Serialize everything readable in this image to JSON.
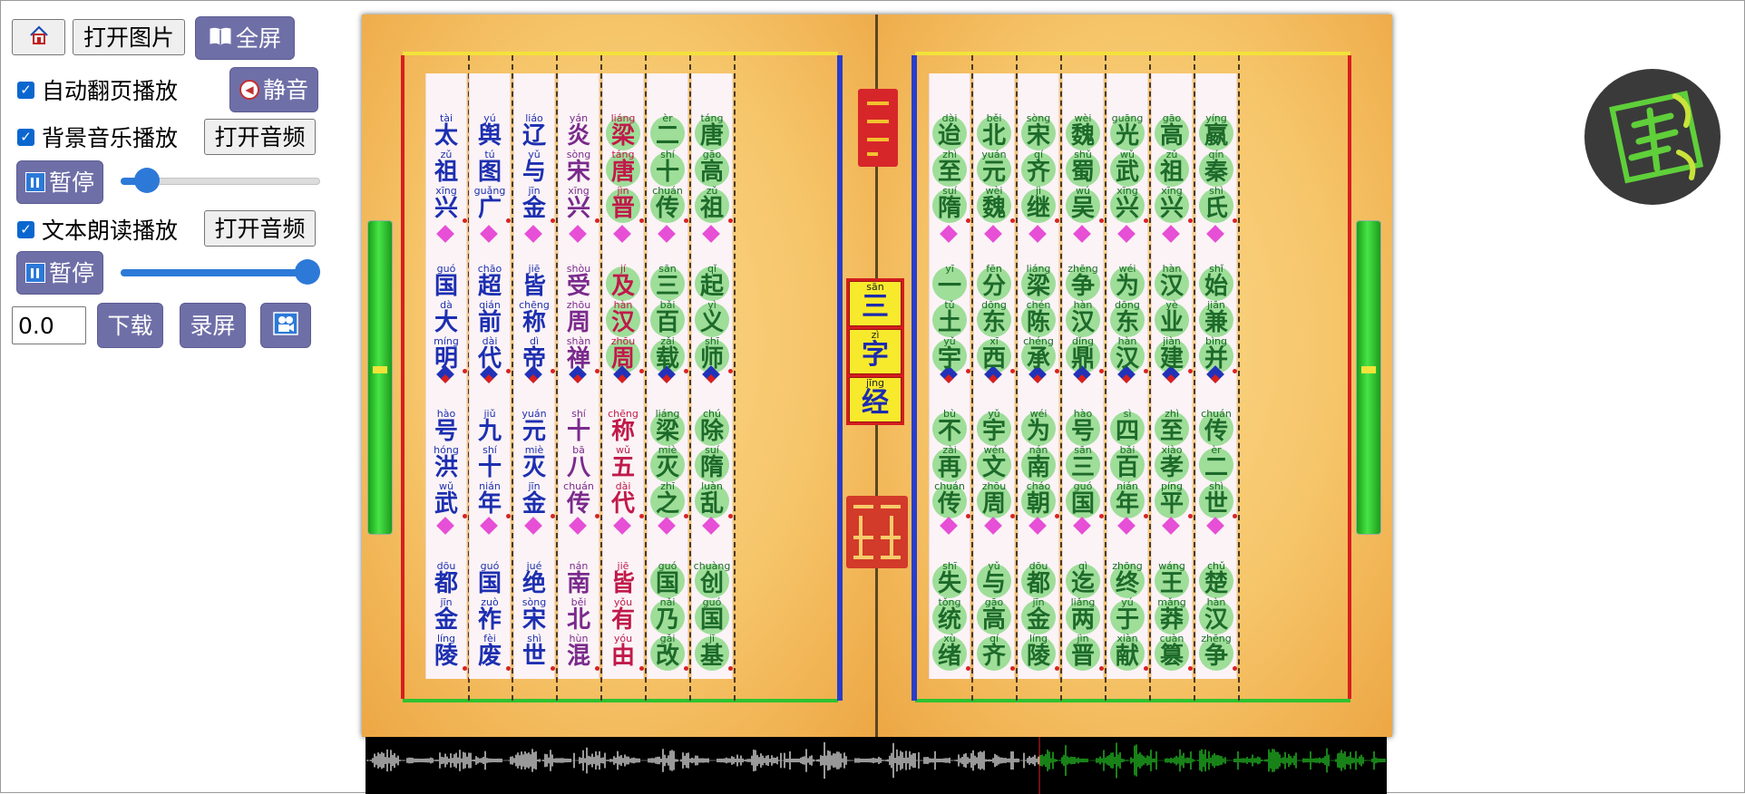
{
  "toolbar": {
    "home_icon": "home-icon",
    "open_image_label": "打开图片",
    "fullscreen_label": "全屏",
    "fullscreen_icon": "book-icon"
  },
  "controls": {
    "auto_flip": {
      "label": "自动翻页播放",
      "checked": true
    },
    "mute_label": "静音",
    "bg_music": {
      "label": "背景音乐播放",
      "checked": true,
      "open_audio_label": "打开音频"
    },
    "bg_pause_label": "暂停",
    "bg_volume": 0.08,
    "text_read": {
      "label": "文本朗读播放",
      "checked": true,
      "open_audio_label": "打开音频"
    },
    "text_pause_label": "暂停",
    "text_volume": 1.0,
    "time_value": "0.0",
    "download_label": "下载",
    "record_label": "录屏",
    "camera_icon": "camera-icon"
  },
  "book": {
    "title": [
      {
        "py": "sān",
        "hz": "三"
      },
      {
        "py": "zì",
        "hz": "字"
      },
      {
        "py": "jīng",
        "hz": "经"
      }
    ],
    "left_page_columns": [
      {
        "color": "#1d2fb0",
        "groups": [
          [
            [
              "tài",
              "太"
            ],
            [
              "zǔ",
              "祖"
            ],
            [
              "xīng",
              "兴"
            ]
          ],
          [
            [
              "guó",
              "国"
            ],
            [
              "dà",
              "大"
            ],
            [
              "míng",
              "明"
            ]
          ],
          [
            [
              "hào",
              "号"
            ],
            [
              "hóng",
              "洪"
            ],
            [
              "wǔ",
              "武"
            ]
          ],
          [
            [
              "dōu",
              "都"
            ],
            [
              "jīn",
              "金"
            ],
            [
              "líng",
              "陵"
            ]
          ]
        ]
      },
      {
        "color": "#1d2fb0",
        "groups": [
          [
            [
              "yú",
              "舆"
            ],
            [
              "tú",
              "图"
            ],
            [
              "guǎng",
              "广"
            ]
          ],
          [
            [
              "chāo",
              "超"
            ],
            [
              "qián",
              "前"
            ],
            [
              "dài",
              "代"
            ]
          ],
          [
            [
              "jiǔ",
              "九"
            ],
            [
              "shí",
              "十"
            ],
            [
              "nián",
              "年"
            ]
          ],
          [
            [
              "guó",
              "国"
            ],
            [
              "zuò",
              "祚"
            ],
            [
              "fèi",
              "废"
            ]
          ]
        ]
      },
      {
        "color": "#1d2fb0",
        "groups": [
          [
            [
              "liáo",
              "辽"
            ],
            [
              "yǔ",
              "与"
            ],
            [
              "jīn",
              "金"
            ]
          ],
          [
            [
              "jiē",
              "皆"
            ],
            [
              "chēng",
              "称"
            ],
            [
              "dì",
              "帝"
            ]
          ],
          [
            [
              "yuán",
              "元"
            ],
            [
              "miè",
              "灭"
            ],
            [
              "jīn",
              "金"
            ]
          ],
          [
            [
              "jué",
              "绝"
            ],
            [
              "sòng",
              "宋"
            ],
            [
              "shì",
              "世"
            ]
          ]
        ]
      },
      {
        "color": "#7a2a8c",
        "groups": [
          [
            [
              "yán",
              "炎"
            ],
            [
              "sòng",
              "宋"
            ],
            [
              "xīng",
              "兴"
            ]
          ],
          [
            [
              "shòu",
              "受"
            ],
            [
              "zhōu",
              "周"
            ],
            [
              "shàn",
              "禅"
            ]
          ],
          [
            [
              "shí",
              "十"
            ],
            [
              "bā",
              "八"
            ],
            [
              "chuán",
              "传"
            ]
          ],
          [
            [
              "nán",
              "南"
            ],
            [
              "běi",
              "北"
            ],
            [
              "hùn",
              "混"
            ]
          ]
        ]
      },
      {
        "color": "#c01a4a",
        "hl": [
          0,
          1
        ],
        "groups": [
          [
            [
              "liáng",
              "梁"
            ],
            [
              "táng",
              "唐"
            ],
            [
              "jìn",
              "晋"
            ]
          ],
          [
            [
              "jí",
              "及"
            ],
            [
              "hàn",
              "汉"
            ],
            [
              "zhōu",
              "周"
            ]
          ],
          [
            [
              "chēng",
              "称"
            ],
            [
              "wǔ",
              "五"
            ],
            [
              "dài",
              "代"
            ]
          ],
          [
            [
              "jiē",
              "皆"
            ],
            [
              "yǒu",
              "有"
            ],
            [
              "yóu",
              "由"
            ]
          ]
        ]
      },
      {
        "color": "#1d6a2a",
        "hl": [
          0,
          1,
          2,
          3
        ],
        "groups": [
          [
            [
              "èr",
              "二"
            ],
            [
              "shí",
              "十"
            ],
            [
              "chuán",
              "传"
            ]
          ],
          [
            [
              "sān",
              "三"
            ],
            [
              "bǎi",
              "百"
            ],
            [
              "zǎi",
              "载"
            ]
          ],
          [
            [
              "liáng",
              "梁"
            ],
            [
              "miè",
              "灭"
            ],
            [
              "zhī",
              "之"
            ]
          ],
          [
            [
              "guó",
              "国"
            ],
            [
              "nǎi",
              "乃"
            ],
            [
              "gǎi",
              "改"
            ]
          ]
        ]
      },
      {
        "color": "#1d6a2a",
        "hl": [
          0,
          1,
          2,
          3
        ],
        "groups": [
          [
            [
              "táng",
              "唐"
            ],
            [
              "gāo",
              "高"
            ],
            [
              "zǔ",
              "祖"
            ]
          ],
          [
            [
              "qǐ",
              "起"
            ],
            [
              "yì",
              "义"
            ],
            [
              "shī",
              "师"
            ]
          ],
          [
            [
              "chú",
              "除"
            ],
            [
              "suí",
              "隋"
            ],
            [
              "luàn",
              "乱"
            ]
          ],
          [
            [
              "chuàng",
              "创"
            ],
            [
              "guó",
              "国"
            ],
            [
              "jī",
              "基"
            ]
          ]
        ]
      }
    ],
    "right_page_columns": [
      {
        "color": "#1d6a2a",
        "hl": [
          0,
          1,
          2,
          3
        ],
        "groups": [
          [
            [
              "dài",
              "迨"
            ],
            [
              "zhì",
              "至"
            ],
            [
              "suí",
              "隋"
            ]
          ],
          [
            [
              "yī",
              "一"
            ],
            [
              "tǔ",
              "土"
            ],
            [
              "yǔ",
              "宇"
            ]
          ],
          [
            [
              "bù",
              "不"
            ],
            [
              "zài",
              "再"
            ],
            [
              "chuán",
              "传"
            ]
          ],
          [
            [
              "shī",
              "失"
            ],
            [
              "tǒng",
              "统"
            ],
            [
              "xù",
              "绪"
            ]
          ]
        ]
      },
      {
        "color": "#1d6a2a",
        "hl": [
          0,
          1,
          2,
          3
        ],
        "groups": [
          [
            [
              "běi",
              "北"
            ],
            [
              "yuán",
              "元"
            ],
            [
              "wèi",
              "魏"
            ]
          ],
          [
            [
              "fēn",
              "分"
            ],
            [
              "dōng",
              "东"
            ],
            [
              "xī",
              "西"
            ]
          ],
          [
            [
              "yǔ",
              "宇"
            ],
            [
              "wén",
              "文"
            ],
            [
              "zhōu",
              "周"
            ]
          ],
          [
            [
              "yǔ",
              "与"
            ],
            [
              "gāo",
              "高"
            ],
            [
              "qí",
              "齐"
            ]
          ]
        ]
      },
      {
        "color": "#1d6a2a",
        "hl": [
          0,
          1,
          2,
          3
        ],
        "groups": [
          [
            [
              "sòng",
              "宋"
            ],
            [
              "qí",
              "齐"
            ],
            [
              "jì",
              "继"
            ]
          ],
          [
            [
              "liáng",
              "梁"
            ],
            [
              "chén",
              "陈"
            ],
            [
              "chéng",
              "承"
            ]
          ],
          [
            [
              "wéi",
              "为"
            ],
            [
              "nán",
              "南"
            ],
            [
              "cháo",
              "朝"
            ]
          ],
          [
            [
              "dōu",
              "都"
            ],
            [
              "jīn",
              "金"
            ],
            [
              "líng",
              "陵"
            ]
          ]
        ]
      },
      {
        "color": "#1d6a2a",
        "hl": [
          0,
          1,
          2,
          3
        ],
        "groups": [
          [
            [
              "wèi",
              "魏"
            ],
            [
              "shǔ",
              "蜀"
            ],
            [
              "wú",
              "吴"
            ]
          ],
          [
            [
              "zhēng",
              "争"
            ],
            [
              "hàn",
              "汉"
            ],
            [
              "dǐng",
              "鼎"
            ]
          ],
          [
            [
              "hào",
              "号"
            ],
            [
              "sān",
              "三"
            ],
            [
              "guó",
              "国"
            ]
          ],
          [
            [
              "qì",
              "迄"
            ],
            [
              "liǎng",
              "两"
            ],
            [
              "jìn",
              "晋"
            ]
          ]
        ]
      },
      {
        "color": "#1d6a2a",
        "hl": [
          0,
          1,
          2,
          3
        ],
        "groups": [
          [
            [
              "guāng",
              "光"
            ],
            [
              "wǔ",
              "武"
            ],
            [
              "xīng",
              "兴"
            ]
          ],
          [
            [
              "wéi",
              "为"
            ],
            [
              "dōng",
              "东"
            ],
            [
              "hàn",
              "汉"
            ]
          ],
          [
            [
              "sì",
              "四"
            ],
            [
              "bǎi",
              "百"
            ],
            [
              "nián",
              "年"
            ]
          ],
          [
            [
              "zhōng",
              "终"
            ],
            [
              "yú",
              "于"
            ],
            [
              "xiàn",
              "献"
            ]
          ]
        ]
      },
      {
        "color": "#1d6a2a",
        "hl": [
          0,
          1,
          2,
          3
        ],
        "groups": [
          [
            [
              "gāo",
              "高"
            ],
            [
              "zǔ",
              "祖"
            ],
            [
              "xīng",
              "兴"
            ]
          ],
          [
            [
              "hàn",
              "汉"
            ],
            [
              "yè",
              "业"
            ],
            [
              "jiàn",
              "建"
            ]
          ],
          [
            [
              "zhì",
              "至"
            ],
            [
              "xiào",
              "孝"
            ],
            [
              "píng",
              "平"
            ]
          ],
          [
            [
              "wáng",
              "王"
            ],
            [
              "mǎng",
              "莽"
            ],
            [
              "cuàn",
              "篡"
            ]
          ]
        ]
      },
      {
        "color": "#1d6a2a",
        "hl": [
          0,
          1,
          2,
          3
        ],
        "groups": [
          [
            [
              "yíng",
              "嬴"
            ],
            [
              "qín",
              "秦"
            ],
            [
              "shì",
              "氏"
            ]
          ],
          [
            [
              "shǐ",
              "始"
            ],
            [
              "jiān",
              "兼"
            ],
            [
              "bìng",
              "并"
            ]
          ],
          [
            [
              "chuán",
              "传"
            ],
            [
              "èr",
              "二"
            ],
            [
              "shì",
              "世"
            ]
          ],
          [
            [
              "chǔ",
              "楚"
            ],
            [
              "hàn",
              "汉"
            ],
            [
              "zhēng",
              "争"
            ]
          ]
        ]
      }
    ]
  },
  "waveform": {
    "played_fraction": 0.66,
    "played_color": "#ffffff",
    "unplayed_color": "#29d929",
    "cursor_color": "#e02020"
  },
  "logo": {
    "icon": "logo-seal-icon"
  }
}
